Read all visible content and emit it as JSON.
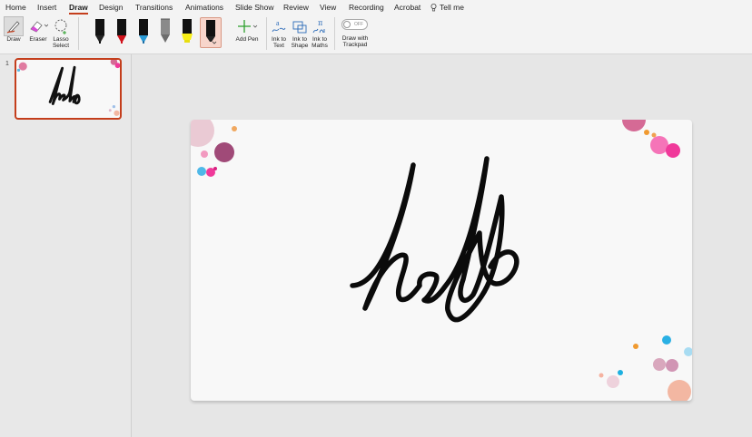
{
  "menu": {
    "tabs": [
      {
        "label": "Home"
      },
      {
        "label": "Insert"
      },
      {
        "label": "Draw"
      },
      {
        "label": "Design"
      },
      {
        "label": "Transitions"
      },
      {
        "label": "Animations"
      },
      {
        "label": "Slide Show"
      },
      {
        "label": "Review"
      },
      {
        "label": "View"
      },
      {
        "label": "Recording"
      },
      {
        "label": "Acrobat"
      }
    ],
    "active_tab": "Draw",
    "tell_me": "Tell me"
  },
  "ribbon": {
    "draw_label": "Draw",
    "eraser_label": "Eraser",
    "lasso_label": "Lasso Select",
    "add_pen_label": "Add Pen",
    "ink_to_text_label": "Ink to Text",
    "ink_to_shape_label": "Ink to Shape",
    "ink_to_maths_label": "Ink to Maths",
    "draw_with_trackpad_label": "Draw with Trackpad",
    "toggle_state": "OFF",
    "pens": [
      {
        "name": "black-pen",
        "color": "#111111"
      },
      {
        "name": "red-pen",
        "color": "#d0111a"
      },
      {
        "name": "galaxy-pen",
        "color": "#2a9ad6"
      },
      {
        "name": "gray-pencil",
        "color": "#8a8a8a"
      },
      {
        "name": "yellow-highlighter",
        "color": "#f7ee16"
      },
      {
        "name": "black-pen-selected",
        "color": "#111111"
      }
    ]
  },
  "slides": {
    "current_number": "1"
  },
  "colors": {
    "accent": "#c43e1c",
    "selected_pen_bg": "#f7d5cb",
    "slide_bg": "#f8f8f8"
  }
}
